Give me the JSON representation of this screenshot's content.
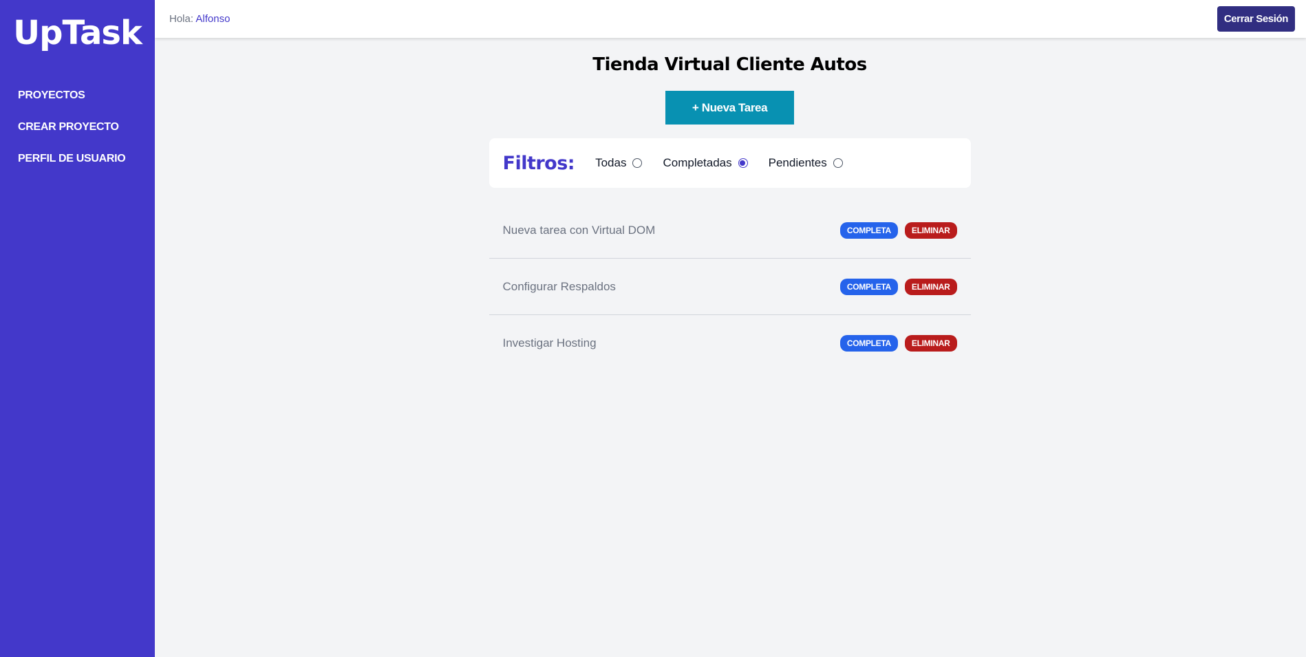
{
  "sidebar": {
    "logo": "UpTask",
    "items": [
      {
        "label": "PROYECTOS"
      },
      {
        "label": "CREAR PROYECTO"
      },
      {
        "label": "PERFIL DE USUARIO"
      }
    ]
  },
  "header": {
    "greeting": "Hola:",
    "user": "Alfonso",
    "logout_label": "Cerrar Sesión"
  },
  "main": {
    "title": "Tienda Virtual Cliente Autos",
    "new_task_label": "+ Nueva Tarea",
    "filters": {
      "title": "Filtros:",
      "options": [
        {
          "label": "Todas",
          "checked": false
        },
        {
          "label": "Completadas",
          "checked": true
        },
        {
          "label": "Pendientes",
          "checked": false
        }
      ]
    },
    "tasks": [
      {
        "name": "Nueva tarea con Virtual DOM",
        "status_label": "Completa",
        "delete_label": "Eliminar"
      },
      {
        "name": "Configurar Respaldos",
        "status_label": "Completa",
        "delete_label": "Eliminar"
      },
      {
        "name": "Investigar Hosting",
        "status_label": "Completa",
        "delete_label": "Eliminar"
      }
    ]
  },
  "colors": {
    "sidebar": "#4338ca",
    "accent": "#4338ca",
    "logout": "#312e81",
    "new_task": "#0891b2",
    "complete": "#2563eb",
    "delete": "#b91c1c",
    "background": "#f3f4f6"
  }
}
